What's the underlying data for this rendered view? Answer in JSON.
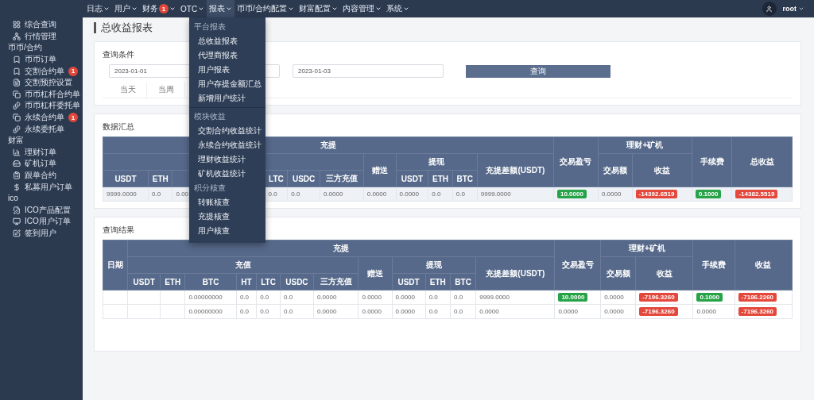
{
  "nav": {
    "items": [
      {
        "label": "日志",
        "expanded": false
      },
      {
        "label": "用户",
        "expanded": false
      },
      {
        "label": "财务",
        "badge": "1",
        "expanded": false
      },
      {
        "label": "OTC",
        "expanded": false
      },
      {
        "label": "报表",
        "expanded": true,
        "menu": [
          {
            "kind": "section",
            "label": "平台报表"
          },
          {
            "kind": "item",
            "label": "总收益报表"
          },
          {
            "kind": "item",
            "label": "代理商报表"
          },
          {
            "kind": "item",
            "label": "用户报表"
          },
          {
            "kind": "item",
            "label": "用户存提金额汇总"
          },
          {
            "kind": "item",
            "label": "新增用户统计"
          },
          {
            "kind": "divider"
          },
          {
            "kind": "section",
            "label": "模块收益"
          },
          {
            "kind": "item",
            "label": "交割合约收益统计"
          },
          {
            "kind": "item",
            "label": "永续合约收益统计"
          },
          {
            "kind": "item",
            "label": "理财收益统计"
          },
          {
            "kind": "item",
            "label": "矿机收益统计"
          },
          {
            "kind": "section",
            "label": "积分核查"
          },
          {
            "kind": "item",
            "label": "转账核查"
          },
          {
            "kind": "item",
            "label": "充提核查"
          },
          {
            "kind": "item",
            "label": "用户核查"
          }
        ]
      },
      {
        "label": "币币/合约配置",
        "expanded": false
      },
      {
        "label": "财富配置",
        "expanded": false
      },
      {
        "label": "内容管理",
        "expanded": false
      },
      {
        "label": "系统",
        "expanded": false
      }
    ],
    "user": {
      "name": "root"
    }
  },
  "sidebar": {
    "items": [
      {
        "kind": "link",
        "label": "综合查询"
      },
      {
        "kind": "link",
        "label": "行情管理"
      },
      {
        "kind": "section",
        "label": "币币/合约"
      },
      {
        "kind": "link",
        "label": "币币订单"
      },
      {
        "kind": "link",
        "label": "交割合约单",
        "badge": "1"
      },
      {
        "kind": "link",
        "label": "交割预控设置"
      },
      {
        "kind": "link",
        "label": "币币杠杆合约单"
      },
      {
        "kind": "link",
        "label": "币币杠杆委托单"
      },
      {
        "kind": "link",
        "label": "永续合约单",
        "badge": "1"
      },
      {
        "kind": "link",
        "label": "永续委托单"
      },
      {
        "kind": "section",
        "label": "财富"
      },
      {
        "kind": "link",
        "label": "理财订单"
      },
      {
        "kind": "link",
        "label": "矿机订单"
      },
      {
        "kind": "link",
        "label": "跟单合约"
      },
      {
        "kind": "link",
        "label": "私募用户订单"
      },
      {
        "kind": "section",
        "label": "ico"
      },
      {
        "kind": "link",
        "label": "ICO产品配置"
      },
      {
        "kind": "link",
        "label": "ICO用户订单"
      },
      {
        "kind": "link",
        "label": "签到用户"
      }
    ]
  },
  "page_title": "总收益报表",
  "query": {
    "title": "查询条件",
    "date_fields": [
      {
        "value": "2023-01-01"
      },
      {
        "value": "2023-01-03"
      }
    ],
    "search_button": "查询",
    "quick_ranges": [
      "当天",
      "当周"
    ]
  },
  "summary": {
    "title": "数据汇总",
    "columns": [
      {
        "label": "充提",
        "colspan": 12,
        "children": [
          {
            "colspan": 7,
            "children": [
              {
                "kind": "heading",
                "label": "USDT"
              },
              {
                "kind": "heading",
                "label": "ETH"
              },
              {
                "kind": "covered"
              },
              {
                "kind": "covered"
              },
              {
                "kind": "heading",
                "label": "LTC"
              },
              {
                "kind": "heading",
                "label": "USDC"
              },
              {
                "kind": "heading",
                "label": "三方充值"
              }
            ]
          },
          {
            "label": "赠送"
          },
          {
            "label": "提现",
            "children": [
              {
                "label": "USDT"
              },
              {
                "label": "ETH"
              },
              {
                "label": "BTC"
              }
            ]
          },
          {
            "label": "充提差额(USDT)"
          }
        ]
      },
      {
        "label": "交易盈亏"
      },
      {
        "label": "理财+矿机",
        "colspan": 2,
        "children": [
          {
            "label": "交易额"
          },
          {
            "label": "收益"
          }
        ]
      },
      {
        "label": "手续费"
      },
      {
        "label": "总收益"
      }
    ],
    "rows": [
      [
        {
          "kind": "plain",
          "text": "9999.0000"
        },
        {
          "kind": "plain",
          "text": "0.0"
        },
        {
          "kind": "plain",
          "text": "0.00"
        },
        {
          "kind": "blank"
        },
        {
          "kind": "plain",
          "text": "0.0"
        },
        {
          "kind": "plain",
          "text": "0.0"
        },
        {
          "kind": "plain",
          "text": "0.0000"
        },
        {
          "kind": "plain",
          "text": "0.0000"
        },
        {
          "kind": "plain",
          "text": "0.0000"
        },
        {
          "kind": "plain",
          "text": "0.0"
        },
        {
          "kind": "plain",
          "text": "0.0"
        },
        {
          "kind": "plain",
          "text": "9999.0000"
        },
        {
          "kind": "gain",
          "text": "10.0000"
        },
        {
          "kind": "plain",
          "text": "0.0000"
        },
        {
          "kind": "loss",
          "text": "-14392.6519"
        },
        {
          "kind": "gain",
          "text": "0.1000"
        },
        {
          "kind": "loss",
          "text": "-14382.5519"
        }
      ]
    ]
  },
  "results": {
    "title": "查询结果",
    "columns": [
      {
        "label": "日期"
      },
      {
        "label": "充提",
        "colspan": 12,
        "children": [
          {
            "label": "充值",
            "colspan": 7,
            "children": [
              {
                "label": "USDT"
              },
              {
                "label": "ETH"
              },
              {
                "label": "BTC"
              },
              {
                "label": "HT"
              },
              {
                "label": "LTC"
              },
              {
                "label": "USDC"
              },
              {
                "label": "三方充值"
              }
            ]
          },
          {
            "label": "赠送"
          },
          {
            "label": "提现",
            "children": [
              {
                "label": "USDT"
              },
              {
                "label": "ETH"
              },
              {
                "label": "BTC"
              }
            ]
          },
          {
            "label": "充提差额(USDT)"
          }
        ]
      },
      {
        "label": "交易盈亏"
      },
      {
        "label": "理财+矿机",
        "colspan": 2,
        "children": [
          {
            "label": "交易额"
          },
          {
            "label": "收益"
          }
        ]
      },
      {
        "label": "手续费"
      },
      {
        "label": "收益"
      }
    ],
    "rows": [
      [
        {
          "kind": "blank"
        },
        {
          "kind": "blank"
        },
        {
          "kind": "blank"
        },
        {
          "kind": "plain",
          "text": "0.00000000"
        },
        {
          "kind": "plain",
          "text": "0.0"
        },
        {
          "kind": "plain",
          "text": "0.0"
        },
        {
          "kind": "plain",
          "text": "0.0"
        },
        {
          "kind": "plain",
          "text": "0.0000"
        },
        {
          "kind": "plain",
          "text": "0.0000"
        },
        {
          "kind": "plain",
          "text": "0.0000"
        },
        {
          "kind": "plain",
          "text": "0.0"
        },
        {
          "kind": "plain",
          "text": "0.0"
        },
        {
          "kind": "plain",
          "text": "9999.0000"
        },
        {
          "kind": "gain",
          "text": "10.0000"
        },
        {
          "kind": "plain",
          "text": "0.0000"
        },
        {
          "kind": "loss",
          "text": "-7196.3260"
        },
        {
          "kind": "gain",
          "text": "0.1000"
        },
        {
          "kind": "loss",
          "text": "-7186.2260"
        }
      ],
      [
        {
          "kind": "blank"
        },
        {
          "kind": "blank"
        },
        {
          "kind": "blank"
        },
        {
          "kind": "plain",
          "text": "0.00000000"
        },
        {
          "kind": "plain",
          "text": "0.0"
        },
        {
          "kind": "plain",
          "text": "0.0"
        },
        {
          "kind": "plain",
          "text": "0.0"
        },
        {
          "kind": "plain",
          "text": "0.0000"
        },
        {
          "kind": "plain",
          "text": "0.0000"
        },
        {
          "kind": "plain",
          "text": "0.0000"
        },
        {
          "kind": "plain",
          "text": "0.0"
        },
        {
          "kind": "plain",
          "text": "0.0"
        },
        {
          "kind": "plain",
          "text": "0.0000"
        },
        {
          "kind": "plain",
          "text": "0.0000"
        },
        {
          "kind": "plain",
          "text": "0.0000"
        },
        {
          "kind": "loss",
          "text": "-7196.3260"
        },
        {
          "kind": "plain",
          "text": "0.0000"
        },
        {
          "kind": "loss",
          "text": "-7196.3260"
        }
      ]
    ]
  }
}
